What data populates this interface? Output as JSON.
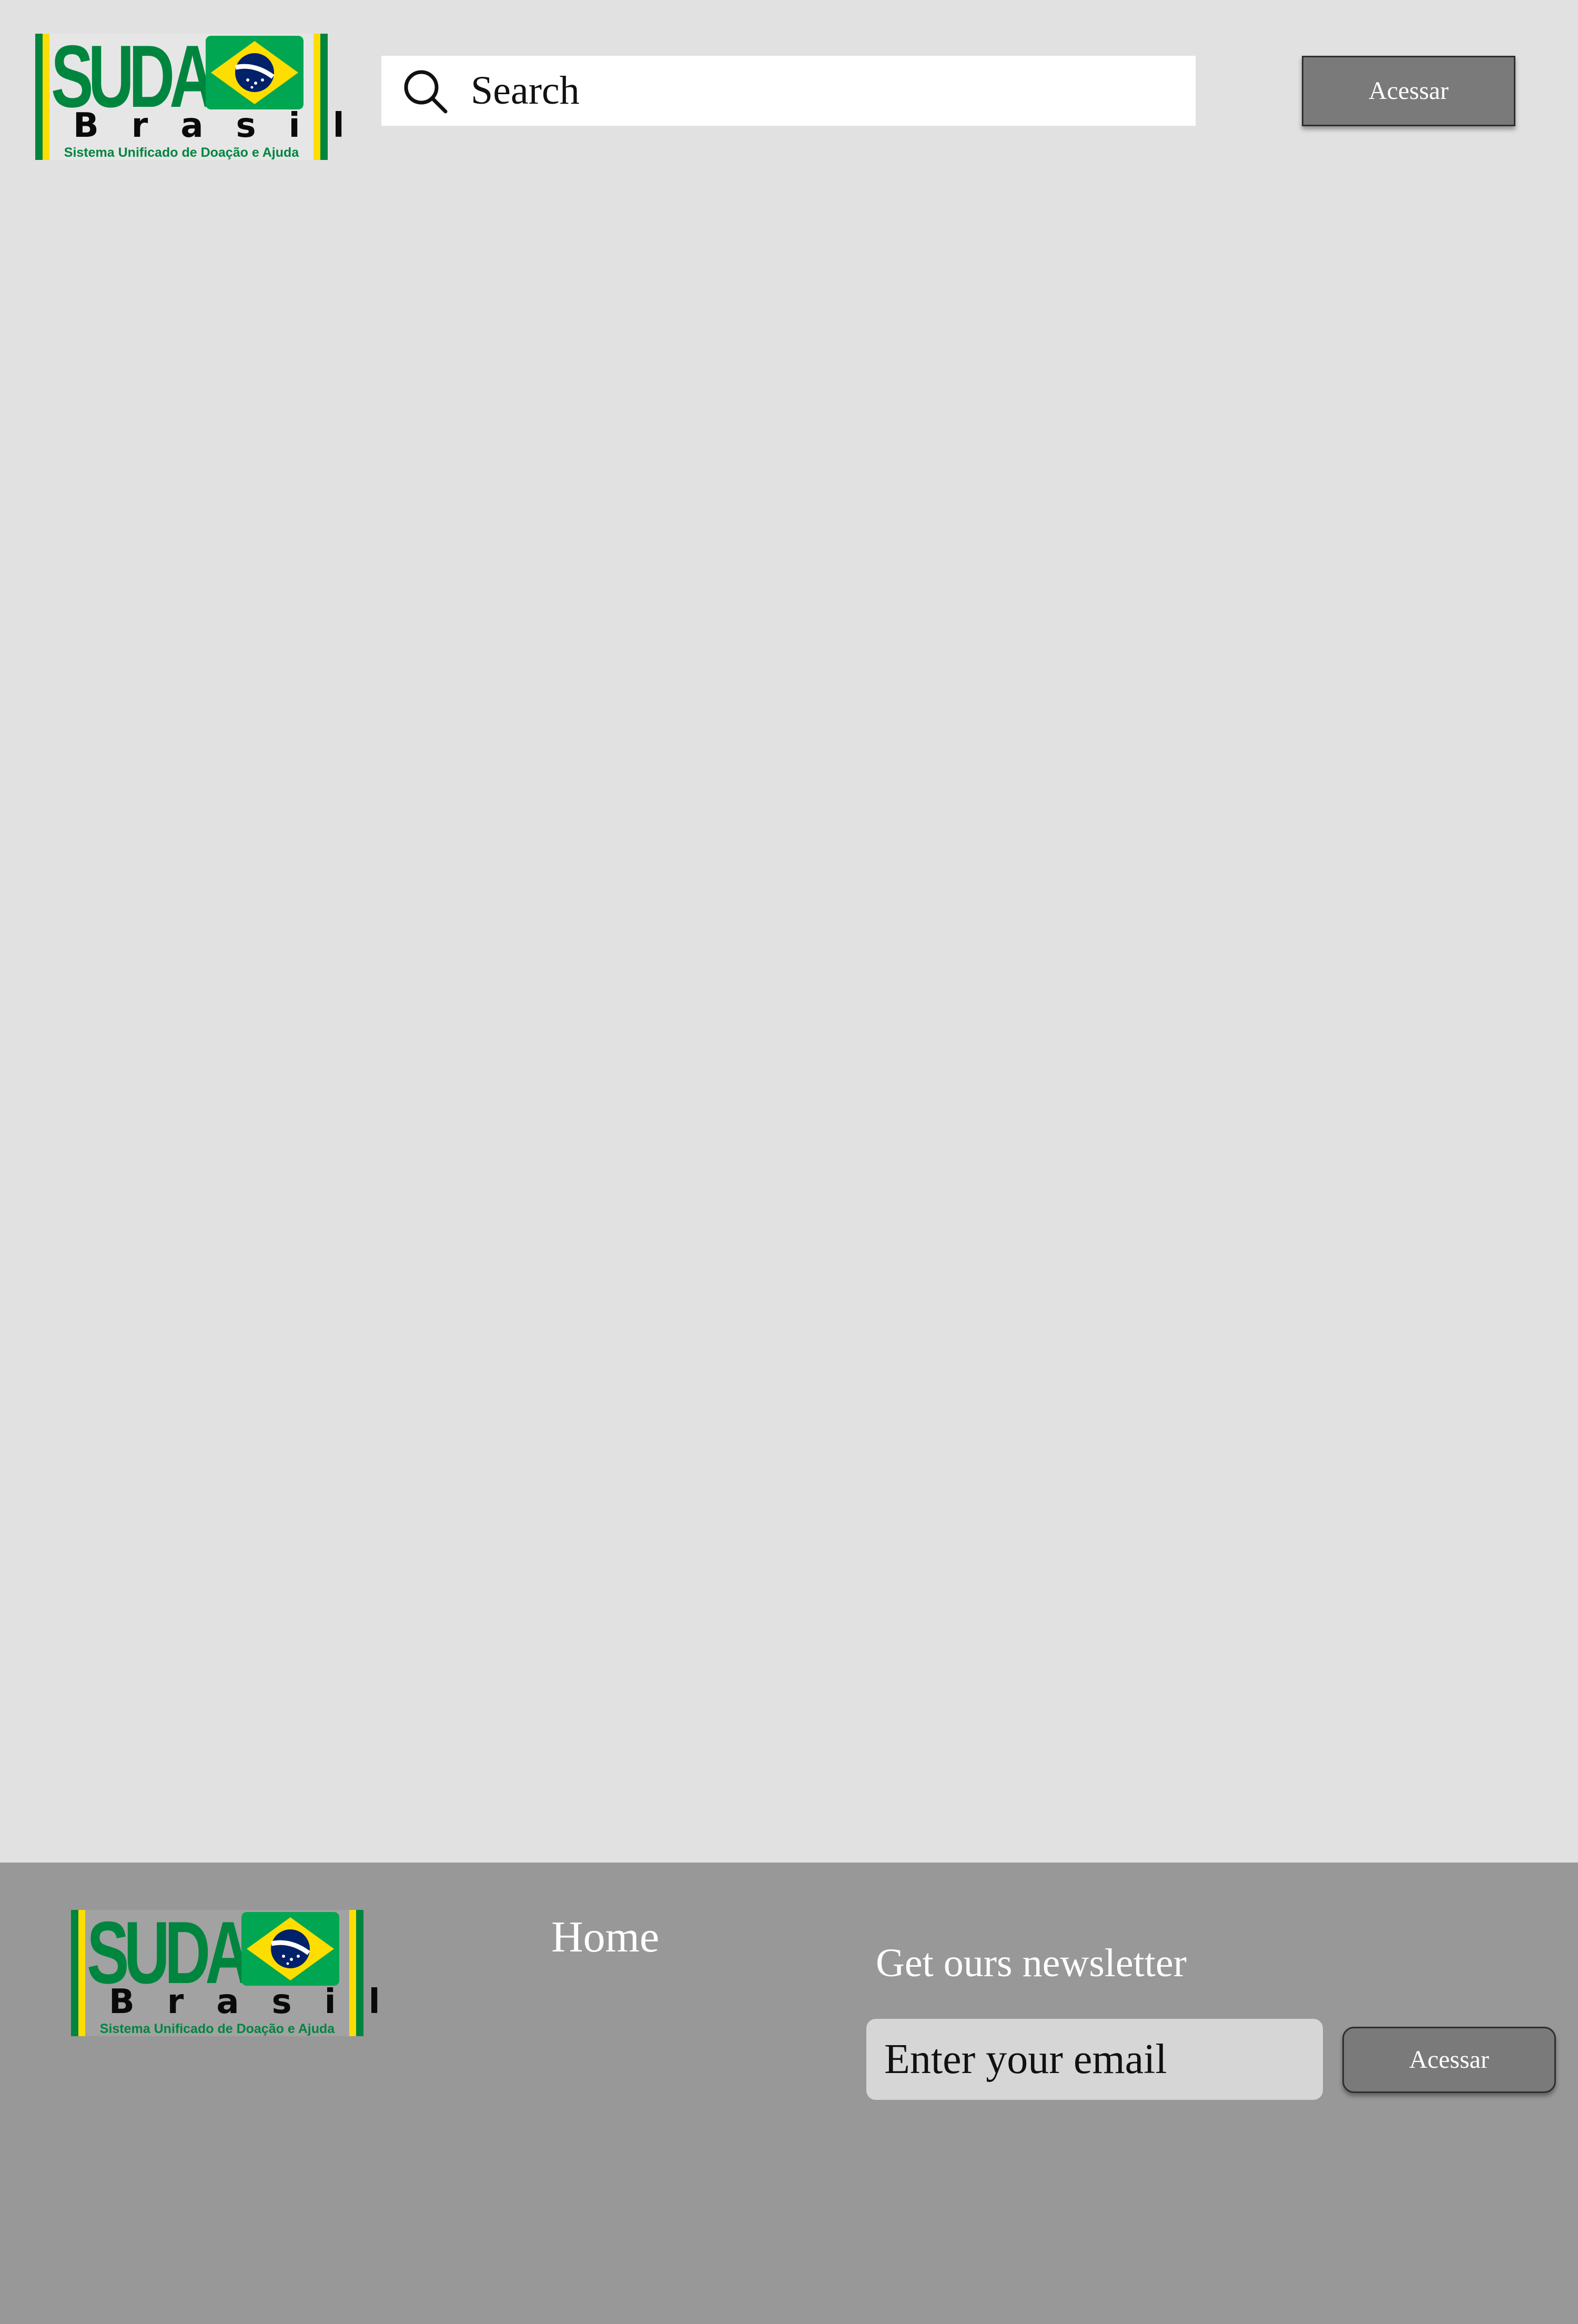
{
  "brand": {
    "name": "SUDA",
    "country": "Brasil",
    "tagline": "Sistema Unificado de Doação e Ajuda",
    "colors": {
      "green": "#00853f",
      "yellow": "#fedd00",
      "blue": "#012169",
      "panel": "#e6e6e6",
      "text": "#0a0a0a"
    }
  },
  "header": {
    "search": {
      "placeholder": "Search",
      "value": "",
      "icon": "search-icon"
    },
    "access_button": "Acessar"
  },
  "footer": {
    "nav": {
      "home": "Home"
    },
    "newsletter": {
      "title": "Get ours newsletter",
      "email_placeholder": "Enter your email",
      "email_value": "",
      "button": "Acessar"
    }
  },
  "colors": {
    "page_bg": "#e1e1e1",
    "footer_bg": "#989898",
    "button_bg": "#7a7a7a",
    "button_text": "#ffffff",
    "search_bg": "#ffffff",
    "input_bg": "#d6d6d6"
  }
}
